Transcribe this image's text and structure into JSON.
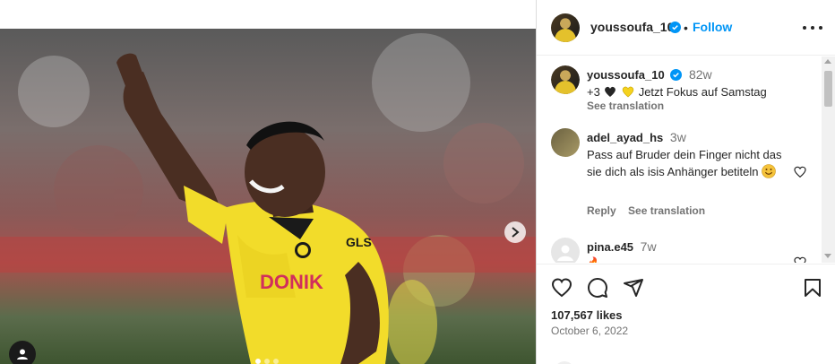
{
  "post": {
    "username": "youssoufa_10",
    "follow_label": "Follow",
    "separator": "•",
    "likes": "107,567 likes",
    "date": "October 6, 2022"
  },
  "caption": {
    "username": "youssoufa_10",
    "time": "82w",
    "text_prefix": "+3",
    "text_suffix": "Jetzt Fokus auf Samstag",
    "see_translation": "See translation"
  },
  "comments": [
    {
      "username": "adel_ayad_hs",
      "time": "3w",
      "text": "Pass auf Bruder dein Finger nicht das sie dich als isis Anhänger betiteln",
      "reply": "Reply",
      "see_translation": "See translation"
    },
    {
      "username": "pina.e45",
      "time": "7w",
      "text": "🔥"
    }
  ],
  "colors": {
    "accent": "#0095f6",
    "verified": "#0095f6",
    "text": "#262626",
    "muted": "#737373",
    "jersey": "#f2dc2a"
  },
  "icons": {
    "more": "more-options-icon",
    "next": "chevron-right-icon",
    "tag": "user-tag-icon",
    "like": "heart-icon",
    "comment": "comment-icon",
    "share": "share-icon",
    "save": "bookmark-icon"
  }
}
